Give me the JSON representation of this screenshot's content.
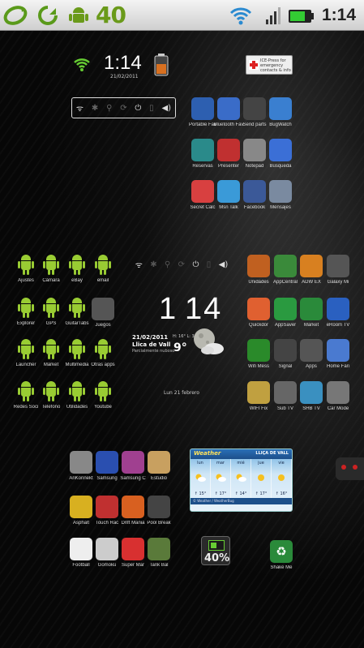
{
  "status_bar": {
    "notification_count": "40",
    "time": "1:14",
    "icons": [
      "sync-icon",
      "refresh-icon",
      "android-notification-icon",
      "wifi-icon",
      "signal-icon",
      "battery-icon"
    ]
  },
  "top_widget": {
    "clock": "1:14",
    "date": "21/02/2011",
    "medical_label": "ICE-Press for emergency contacts & info"
  },
  "screens": {
    "center": {
      "apps": [
        {
          "label": "Portable Fav",
          "icon": "blue-phone-icon",
          "color": "#2d5fb0"
        },
        {
          "label": "Bluetooth Fav",
          "icon": "bluetooth-icon",
          "color": "#3a6cc8"
        },
        {
          "label": "Send parts",
          "icon": "helmet-icon",
          "color": "#444444"
        },
        {
          "label": "BugWatch",
          "icon": "wrench-icon",
          "color": "#3a7fd0"
        },
        {
          "label": "Reservas",
          "icon": "calendar-icon",
          "color": "#2a8a8a"
        },
        {
          "label": "Presenter",
          "icon": "cards-icon",
          "color": "#c03030"
        },
        {
          "label": "Notepad",
          "icon": "printer-icon",
          "color": "#888888"
        },
        {
          "label": "Búsqueda",
          "icon": "google-icon",
          "color": "#3b6fd6"
        },
        {
          "label": "Secret Calc",
          "icon": "calendar-red-icon",
          "color": "#d84040"
        },
        {
          "label": "Msn Talk",
          "icon": "msn-icon",
          "color": "#3a9ad8"
        },
        {
          "label": "Facebook",
          "icon": "facebook-icon",
          "color": "#3b5998"
        },
        {
          "label": "Mensajes",
          "icon": "mail-icon",
          "color": "#7a8aa0"
        }
      ]
    },
    "left": {
      "apps": [
        {
          "label": "Ajustes",
          "icon": "android-settings-icon"
        },
        {
          "label": "Cámara",
          "icon": "android-camera-icon"
        },
        {
          "label": "eBay",
          "icon": "android-ebay-icon"
        },
        {
          "label": "email",
          "icon": "android-email-icon"
        },
        {
          "label": "Explorer",
          "icon": "android-explorer-icon"
        },
        {
          "label": "GPS",
          "icon": "android-gps-icon"
        },
        {
          "label": "GuitarTabs",
          "icon": "android-guitar-icon"
        },
        {
          "label": "Juegos",
          "icon": "gamepad-icon"
        },
        {
          "label": "Launcher",
          "icon": "android-launcher-icon"
        },
        {
          "label": "Market",
          "icon": "android-market-icon"
        },
        {
          "label": "Multimedia",
          "icon": "android-multimedia-icon"
        },
        {
          "label": "Otras apps",
          "icon": "android-apps-icon"
        },
        {
          "label": "Redes Soci",
          "icon": "android-social-icon"
        },
        {
          "label": "Telefono",
          "icon": "android-phone-icon"
        },
        {
          "label": "Utilidades",
          "icon": "android-utils-icon"
        },
        {
          "label": "Youtube",
          "icon": "android-youtube-icon"
        }
      ]
    },
    "middle": {
      "clock_h": "1",
      "clock_m": "14",
      "date": "21/02/2011",
      "city": "Llica de Vall",
      "sub": "Parcialmente nuboso",
      "temp": "9°",
      "range": "H: 16°  L: 3°",
      "label_bottom": "Lun 21 febrero"
    },
    "right": {
      "apps": [
        {
          "label": "Unidades",
          "icon": "chart-icon",
          "color": "#c06020"
        },
        {
          "label": "AppCentral",
          "icon": "gear-green-icon",
          "color": "#3a8a3a"
        },
        {
          "label": "ADW EX",
          "icon": "folder-orange-icon",
          "color": "#d88020"
        },
        {
          "label": "Galaxy Mi",
          "icon": "phone-green-icon",
          "color": "#555555"
        },
        {
          "label": "Quickdor",
          "icon": "q-icon",
          "color": "#e06030"
        },
        {
          "label": "AppSaver",
          "icon": "green-check-icon",
          "color": "#2a9a40"
        },
        {
          "label": "Market",
          "icon": "market-bag-icon",
          "color": "#2a8a3a"
        },
        {
          "label": "eRoom TV",
          "icon": "monitor-icon",
          "color": "#2a60c0"
        },
        {
          "label": "Wifi Mess",
          "icon": "wifi-green-icon",
          "color": "#2a8a2a"
        },
        {
          "label": "Signal",
          "icon": "signal-meter-icon",
          "color": "#444444"
        },
        {
          "label": "Apps",
          "icon": "devices-icon",
          "color": "#555555"
        },
        {
          "label": "Home Fari",
          "icon": "cloud-icon",
          "color": "#4a7ad0"
        },
        {
          "label": "WIFI Fix",
          "icon": "envelope-gold-icon",
          "color": "#c0a040"
        },
        {
          "label": "Sub TV",
          "icon": "tv-icon",
          "color": "#666666"
        },
        {
          "label": "SHB TV",
          "icon": "screen-icon",
          "color": "#3a90c0"
        },
        {
          "label": "Car Mode",
          "icon": "car-icon",
          "color": "#777777"
        }
      ]
    },
    "bottom_left": {
      "apps": [
        {
          "label": "AnKonnekt",
          "icon": "ankonnekt-icon",
          "color": "#888888"
        },
        {
          "label": "Samsung",
          "icon": "samsung-icon",
          "color": "#2a4fb0"
        },
        {
          "label": "Samsung C",
          "icon": "color-wheel-icon",
          "color": "#a04090"
        },
        {
          "label": "Estudio",
          "icon": "scroll-icon",
          "color": "#c8a060"
        },
        {
          "label": "Asphalt",
          "icon": "car-yellow-icon",
          "color": "#d8b020"
        },
        {
          "label": "Touch Rac",
          "icon": "race-icon",
          "color": "#c03030"
        },
        {
          "label": "Drift Mania",
          "icon": "drift-icon",
          "color": "#d86020"
        },
        {
          "label": "Pool Break",
          "icon": "pool-icon",
          "color": "#444444"
        },
        {
          "label": "Football",
          "icon": "football-icon",
          "color": "#eeeeee"
        },
        {
          "label": "Gomoku",
          "icon": "dice-icon",
          "color": "#cccccc"
        },
        {
          "label": "Super Mar",
          "icon": "q-red-icon",
          "color": "#d83030"
        },
        {
          "label": "Tank Bal",
          "icon": "tank-icon",
          "color": "#5a7a3a"
        }
      ],
      "battery_percent": "40%",
      "extra_app": {
        "label": "Shake Me",
        "icon": "recycle-icon",
        "color": "#2a8a3a"
      }
    },
    "weather": {
      "brand": "Weather",
      "city": "LLIÇA DE VALL",
      "days": [
        {
          "name": "lun",
          "temp": "↑ 15°",
          "icon": "sun-cloud-icon"
        },
        {
          "name": "mar",
          "temp": "↑ 17°",
          "icon": "sun-cloud-icon"
        },
        {
          "name": "mié",
          "temp": "↑ 14°",
          "icon": "sun-cloud-icon"
        },
        {
          "name": "jue",
          "temp": "↑ 17°",
          "icon": "sun-icon"
        },
        {
          "name": "vie",
          "temp": "↑ 16°",
          "icon": "sun-icon"
        }
      ],
      "footer": "© Weather / WeatherBug"
    }
  }
}
